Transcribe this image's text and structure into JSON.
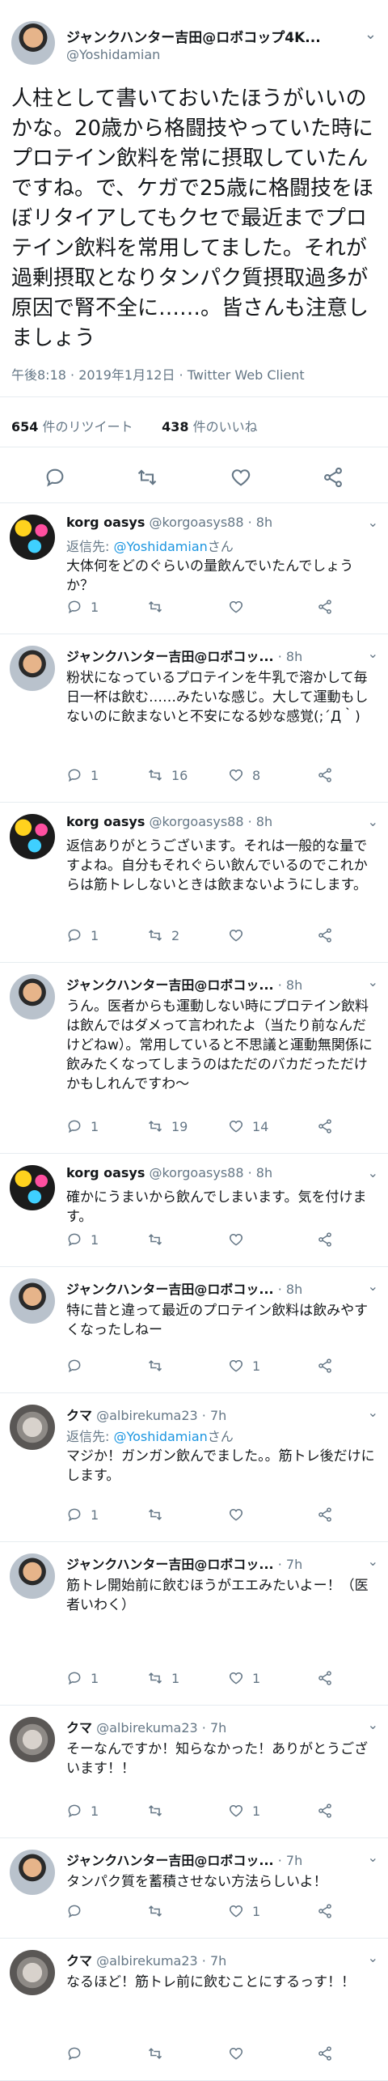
{
  "main_tweet": {
    "name": "ジャンクハンター吉田@ロボコップ4K...",
    "handle": "@Yoshidamian",
    "text": "人柱として書いておいたほうがいいのかな。20歳から格闘技やっていた時にプロテイン飲料を常に摂取していたんですね。で、ケガで25歳に格闘技をほぼリタイアしてもクセで最近までプロテイン飲料を常用してました。それが過剰摂取となりタンパク質摂取過多が原因で腎不全に……。皆さんも注意しましょう",
    "meta": "午後8:18 · 2019年1月12日 · Twitter Web Client",
    "retweets_count": "654",
    "retweets_label": "件のリツイート",
    "likes_count": "438",
    "likes_label": "件のいいね",
    "actions": [
      "reply-icon",
      "retweet-icon",
      "like-icon",
      "share-icon"
    ]
  },
  "replies": [
    {
      "avatar": "korg",
      "name": "korg oasys",
      "handle": "@korgoasys88 · 8h",
      "replying_to_prefix": "返信先: ",
      "replying_to_user": "@Yoshidamian",
      "replying_to_suffix": "さん",
      "text": "大体何をどのぐらいの量飲んでいたんでしょうか？",
      "reply_count": "1",
      "retweet_count": "",
      "like_count": ""
    },
    {
      "avatar": "yoshi",
      "name": "ジャンクハンター吉田@ロボコッ...",
      "handle": "· 8h",
      "text": "粉状になっているプロテインを牛乳で溶かして毎日一杯は飲む……みたいな感じ。大して運動もしないのに飲まないと不安になる妙な感覚(;´Д｀)",
      "reply_count": "1",
      "retweet_count": "16",
      "like_count": "8"
    },
    {
      "avatar": "korg",
      "name": "korg oasys",
      "handle": "@korgoasys88 · 8h",
      "text": "返信ありがとうございます。それは一般的な量ですよね。自分もそれぐらい飲んでいるのでこれからは筋トレしないときは飲まないようにします。",
      "reply_count": "1",
      "retweet_count": "2",
      "like_count": ""
    },
    {
      "avatar": "yoshi",
      "name": "ジャンクハンター吉田@ロボコッ...",
      "handle": "· 8h",
      "text": "うん。医者からも運動しない時にプロテイン飲料は飲んではダメって言われたよ（当たり前なんだけどねw）。常用していると不思議と運動無関係に飲みたくなってしまうのはただのバカだっただけかもしれんですわ〜",
      "reply_count": "1",
      "retweet_count": "19",
      "like_count": "14"
    },
    {
      "avatar": "korg",
      "name": "korg oasys",
      "handle": "@korgoasys88 · 8h",
      "text": "確かにうまいから飲んでしまいます。気を付けます。",
      "reply_count": "1",
      "retweet_count": "",
      "like_count": ""
    },
    {
      "avatar": "yoshi",
      "name": "ジャンクハンター吉田@ロボコッ...",
      "handle": "· 8h",
      "text": "特に昔と違って最近のプロテイン飲料は飲みやすくなったしねー",
      "reply_count": "",
      "retweet_count": "",
      "like_count": "1"
    },
    {
      "avatar": "kuma",
      "name": "クマ",
      "handle": "@albirekuma23 · 7h",
      "replying_to_prefix": "返信先: ",
      "replying_to_user": "@Yoshidamian",
      "replying_to_suffix": "さん",
      "text": "マジか！ガンガン飲んでました。。筋トレ後だけにします。",
      "reply_count": "1",
      "retweet_count": "",
      "like_count": ""
    },
    {
      "avatar": "yoshi",
      "name": "ジャンクハンター吉田@ロボコッ...",
      "handle": "· 7h",
      "text": "筋トレ開始前に飲むほうがエエみたいよー！（医者いわく）",
      "reply_count": "1",
      "retweet_count": "1",
      "like_count": "1"
    },
    {
      "avatar": "kuma",
      "name": "クマ",
      "handle": "@albirekuma23 · 7h",
      "text": "そーなんですか！知らなかった！ありがとうございます！！",
      "reply_count": "1",
      "retweet_count": "",
      "like_count": "1"
    },
    {
      "avatar": "yoshi",
      "name": "ジャンクハンター吉田@ロボコッ...",
      "handle": "· 7h",
      "text": "タンパク質を蓄積させない方法らしいよ！",
      "reply_count": "",
      "retweet_count": "",
      "like_count": "1"
    },
    {
      "avatar": "kuma",
      "name": "クマ",
      "handle": "@albirekuma23 · 7h",
      "text": "なるほど！筋トレ前に飲むことにするっす！！",
      "reply_count": "",
      "retweet_count": "",
      "like_count": ""
    }
  ]
}
